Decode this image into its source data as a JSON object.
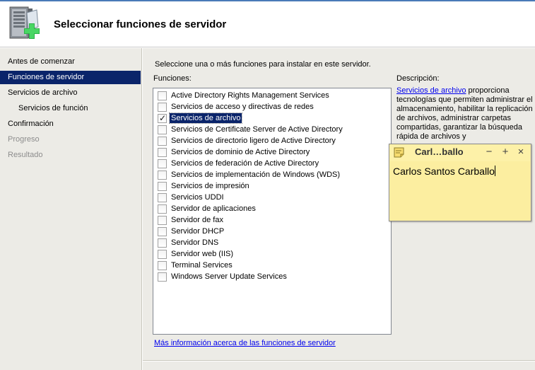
{
  "header": {
    "title": "Seleccionar funciones de servidor",
    "icon": "server-add-icon"
  },
  "sidebar": {
    "items": [
      {
        "label": "Antes de comenzar",
        "state": "normal"
      },
      {
        "label": "Funciones de servidor",
        "state": "active"
      },
      {
        "label": "Servicios de archivo",
        "state": "normal"
      },
      {
        "label": "Servicios de función",
        "state": "normal"
      },
      {
        "label": "Confirmación",
        "state": "normal"
      },
      {
        "label": "Progreso",
        "state": "disabled"
      },
      {
        "label": "Resultado",
        "state": "disabled"
      }
    ]
  },
  "main": {
    "intro": "Seleccione una o más funciones para instalar en este servidor.",
    "roles_label": "Funciones:",
    "roles": [
      {
        "label": "Active Directory Rights Management Services",
        "checked": false
      },
      {
        "label": "Servicios de acceso y directivas de redes",
        "checked": false
      },
      {
        "label": "Servicios de archivo",
        "checked": true
      },
      {
        "label": "Servicios de Certificate Server de Active Directory",
        "checked": false
      },
      {
        "label": "Servicios de directorio ligero de Active Directory",
        "checked": false
      },
      {
        "label": "Servicios de dominio de Active Directory",
        "checked": false
      },
      {
        "label": "Servicios de federación de Active Directory",
        "checked": false
      },
      {
        "label": "Servicios de implementación de Windows (WDS)",
        "checked": false
      },
      {
        "label": "Servicios de impresión",
        "checked": false
      },
      {
        "label": "Servicios UDDI",
        "checked": false
      },
      {
        "label": "Servidor de aplicaciones",
        "checked": false
      },
      {
        "label": "Servidor de fax",
        "checked": false
      },
      {
        "label": "Servidor DHCP",
        "checked": false
      },
      {
        "label": "Servidor DNS",
        "checked": false
      },
      {
        "label": "Servidor web (IIS)",
        "checked": false
      },
      {
        "label": "Terminal Services",
        "checked": false
      },
      {
        "label": "Windows Server Update Services",
        "checked": false
      }
    ],
    "description_title": "Descripción:",
    "description_link": "Servicios de archivo",
    "description_text": " proporciona tecnologías que permiten administrar el almacenamiento, habilitar la replicación de archivos, administrar carpetas compartidas, garantizar la búsqueda rápida de archivos y",
    "more_info_link": "Más información acerca de las funciones de servidor"
  },
  "sticky_note": {
    "title": "Carl…ballo",
    "text": "Carlos Santos Carballo",
    "buttons": {
      "minimize": "−",
      "add": "+",
      "close": "×"
    }
  },
  "colors": {
    "selection": "#0a246a",
    "sidebar_bg": "#ecebe6",
    "note_bg": "#fdf1a8",
    "link": "#0000ee"
  }
}
